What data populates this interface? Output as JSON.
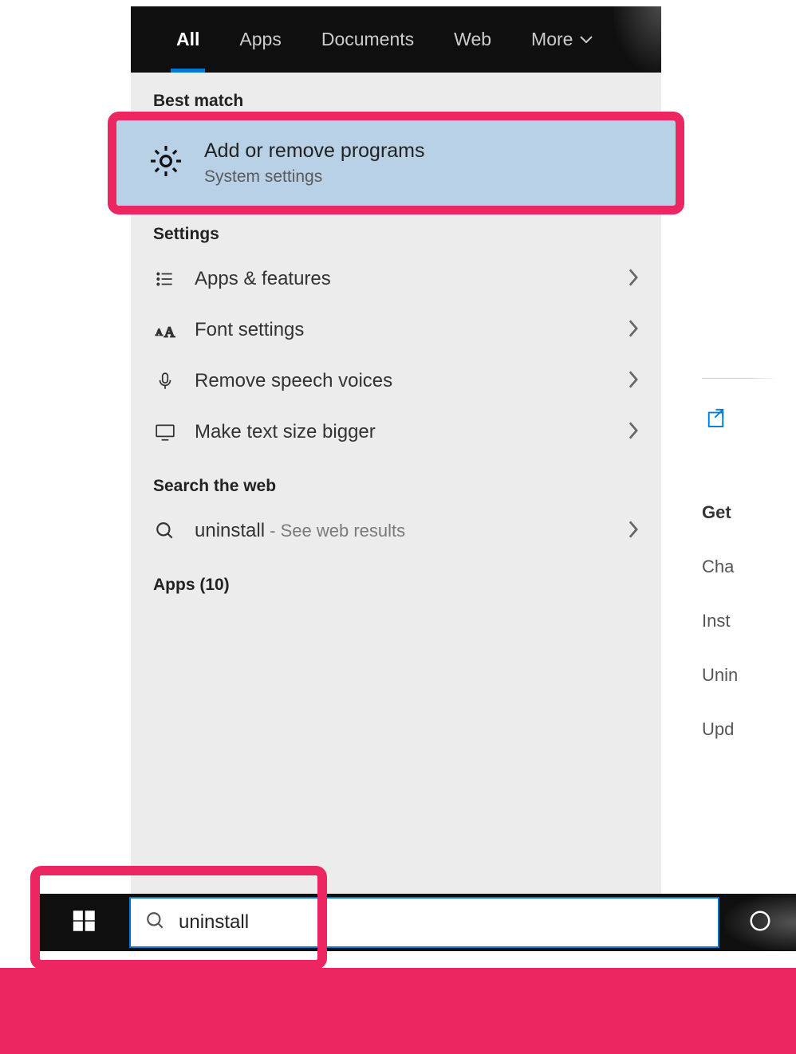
{
  "tabs": {
    "all": "All",
    "apps": "Apps",
    "documents": "Documents",
    "web": "Web",
    "more": "More"
  },
  "sections": {
    "best_match": "Best match",
    "settings": "Settings",
    "search_web": "Search the web",
    "apps_header": "Apps (10)"
  },
  "best_match": {
    "title": "Add or remove programs",
    "subtitle": "System settings"
  },
  "settings_items": {
    "apps_features": "Apps & features",
    "font_settings": "Font settings",
    "remove_speech": "Remove speech voices",
    "text_bigger": "Make text size bigger"
  },
  "web": {
    "term": "uninstall",
    "suffix": " - See web results"
  },
  "search": {
    "value": "uninstall"
  },
  "right": {
    "get": "Get",
    "cha": "Cha",
    "inst": "Inst",
    "unin": "Unin",
    "upd": "Upd"
  },
  "colors": {
    "highlight": "#ec2661",
    "accent": "#0078d4",
    "selected_bg": "#b8d1e6"
  }
}
